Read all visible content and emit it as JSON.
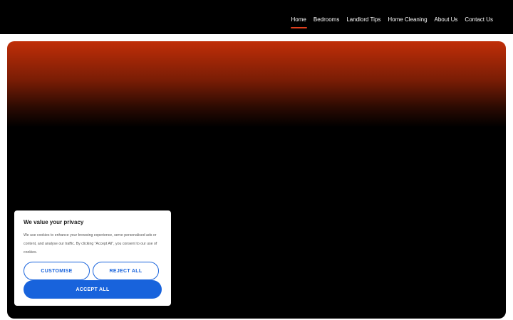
{
  "nav": {
    "items": [
      {
        "label": "Home",
        "active": true
      },
      {
        "label": "Bedrooms"
      },
      {
        "label": "Landlord Tips"
      },
      {
        "label": "Home Cleaning"
      },
      {
        "label": "About Us"
      },
      {
        "label": "Contact Us"
      }
    ]
  },
  "cookie": {
    "title": "We value your privacy",
    "text": "We use cookies to enhance your browsing experience, serve personalised ads or content, and analyse our traffic. By clicking \"Accept All\", you consent to our use of cookies.",
    "customise_label": "CUSTOMISE",
    "reject_label": "REJECT ALL",
    "accept_label": "ACCEPT ALL"
  },
  "colors": {
    "accent": "#e0401e",
    "hero_top": "#c02e08",
    "button_blue": "#1863dc"
  }
}
